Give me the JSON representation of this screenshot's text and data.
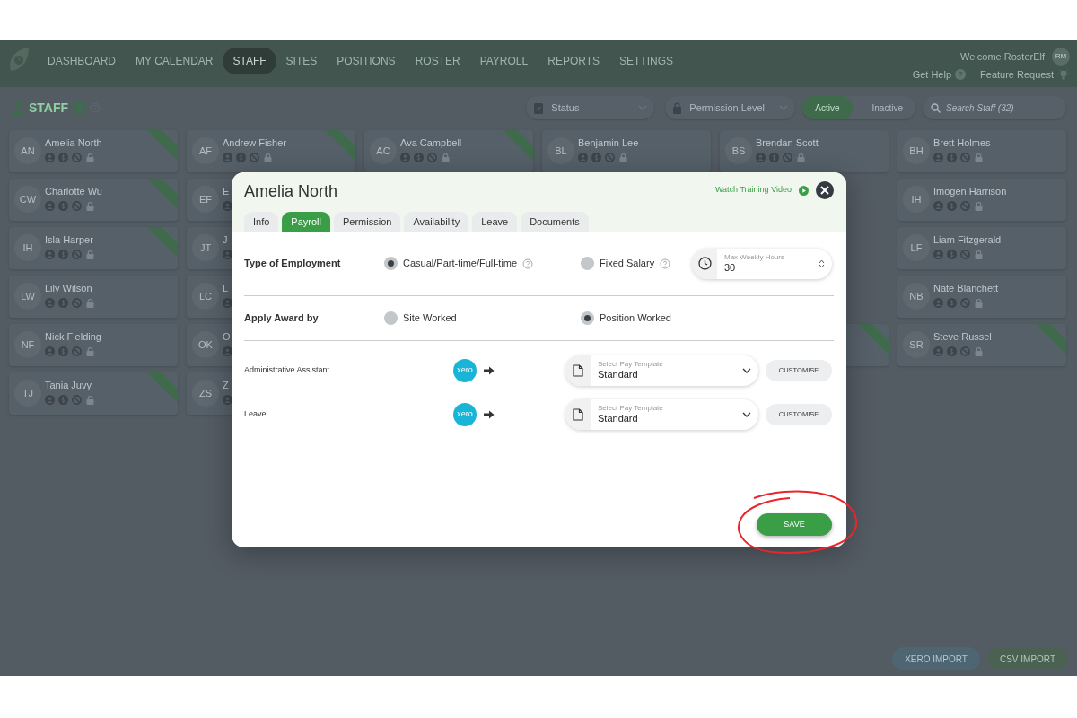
{
  "nav": {
    "items": [
      {
        "label": "DASHBOARD",
        "selected": false
      },
      {
        "label": "MY CALENDAR",
        "selected": false
      },
      {
        "label": "STAFF",
        "selected": true
      },
      {
        "label": "SITES",
        "selected": false
      },
      {
        "label": "POSITIONS",
        "selected": false
      },
      {
        "label": "ROSTER",
        "selected": false
      },
      {
        "label": "PAYROLL",
        "selected": false
      },
      {
        "label": "REPORTS",
        "selected": false
      },
      {
        "label": "SETTINGS",
        "selected": false
      }
    ],
    "welcome": "Welcome RosterElf",
    "avatar": "RM",
    "links": [
      {
        "label": "Get Help",
        "kind": "help"
      },
      {
        "label": "Feature Request",
        "kind": "idea"
      }
    ]
  },
  "staff_bar": {
    "title": "STAFF",
    "status_filter": "Status",
    "permission_filter": "Permission Level",
    "toggle": [
      {
        "label": "Active",
        "selected": true
      },
      {
        "label": "Inactive",
        "selected": false
      }
    ],
    "search": {
      "placeholder": "Search Staff (32)"
    }
  },
  "staff_grid": [
    {
      "start": [
        {
          "initials": "AN",
          "name": "Amelia North",
          "ribbon": true
        },
        {
          "initials": "AF",
          "name": "Andrew Fisher",
          "ribbon": true
        },
        {
          "initials": "AC",
          "name": "Ava Campbell",
          "ribbon": true
        },
        {
          "initials": "BL",
          "name": "Benjamin Lee",
          "ribbon": false
        },
        {
          "initials": "BS",
          "name": "Brendan Scott",
          "ribbon": false
        },
        {
          "initials": "BH",
          "name": "Brett Holmes",
          "ribbon": false
        }
      ]
    },
    {
      "start": [
        {
          "initials": "CW",
          "name": "Charlotte Wu",
          "ribbon": true
        },
        {
          "initials": "EF",
          "name": "E",
          "ribbon": false
        }
      ],
      "end": [
        {
          "initials": "IH",
          "name": "Imogen Harrison",
          "ribbon": false
        }
      ]
    },
    {
      "start": [
        {
          "initials": "IH",
          "name": "Isla Harper",
          "ribbon": true
        },
        {
          "initials": "JT",
          "name": "J",
          "ribbon": false
        }
      ],
      "end": [
        {
          "initials": "LF",
          "name": "Liam Fitzgerald",
          "ribbon": false
        }
      ]
    },
    {
      "start": [
        {
          "initials": "LW",
          "name": "Lily Wilson",
          "ribbon": false
        },
        {
          "initials": "LC",
          "name": "L",
          "ribbon": false
        }
      ],
      "end": [
        {
          "initials": "NB",
          "name": "Nate Blanchett",
          "ribbon": false
        }
      ]
    },
    {
      "start": [
        {
          "initials": "NF",
          "name": "Nick Fielding",
          "ribbon": false
        },
        {
          "initials": "OK",
          "name": "O",
          "ribbon": false
        }
      ],
      "end": [
        {
          "ribbon": true
        },
        {
          "initials": "SR",
          "name": "Steve Russel",
          "ribbon": true
        }
      ]
    },
    {
      "start": [
        {
          "initials": "TJ",
          "name": "Tania Juvy",
          "ribbon": true
        },
        {
          "initials": "ZS",
          "name": "Z",
          "ribbon": false
        }
      ]
    }
  ],
  "import_buttons": [
    "XERO IMPORT",
    "CSV IMPORT"
  ],
  "modal": {
    "title": "Amelia North",
    "video_link": "Watch Training Video",
    "tabs": [
      {
        "label": "Info",
        "selected": false
      },
      {
        "label": "Payroll",
        "selected": true
      },
      {
        "label": "Permission",
        "selected": false
      },
      {
        "label": "Availability",
        "selected": false
      },
      {
        "label": "Leave",
        "selected": false
      },
      {
        "label": "Documents",
        "selected": false
      }
    ],
    "employment": {
      "label": "Type of Employment",
      "options": [
        {
          "label": "Casual/Part-time/Full-time",
          "selected": true
        },
        {
          "label": "Fixed Salary",
          "selected": false
        }
      ],
      "hours_field": {
        "label": "Max Weekly Hours",
        "value": "30"
      }
    },
    "award": {
      "label": "Apply Award by",
      "options": [
        {
          "label": "Site Worked",
          "selected": false
        },
        {
          "label": "Position Worked",
          "selected": true
        }
      ]
    },
    "pay_items": [
      {
        "position": "Administrative Assistant",
        "logo": "xero",
        "template_label": "Select Pay Template",
        "template": "Standard",
        "button": "CUSTOMISE"
      },
      {
        "position": "Leave",
        "logo": "xero",
        "template_label": "Select Pay Template",
        "template": "Standard",
        "button": "CUSTOMISE"
      }
    ],
    "save": "SAVE"
  }
}
